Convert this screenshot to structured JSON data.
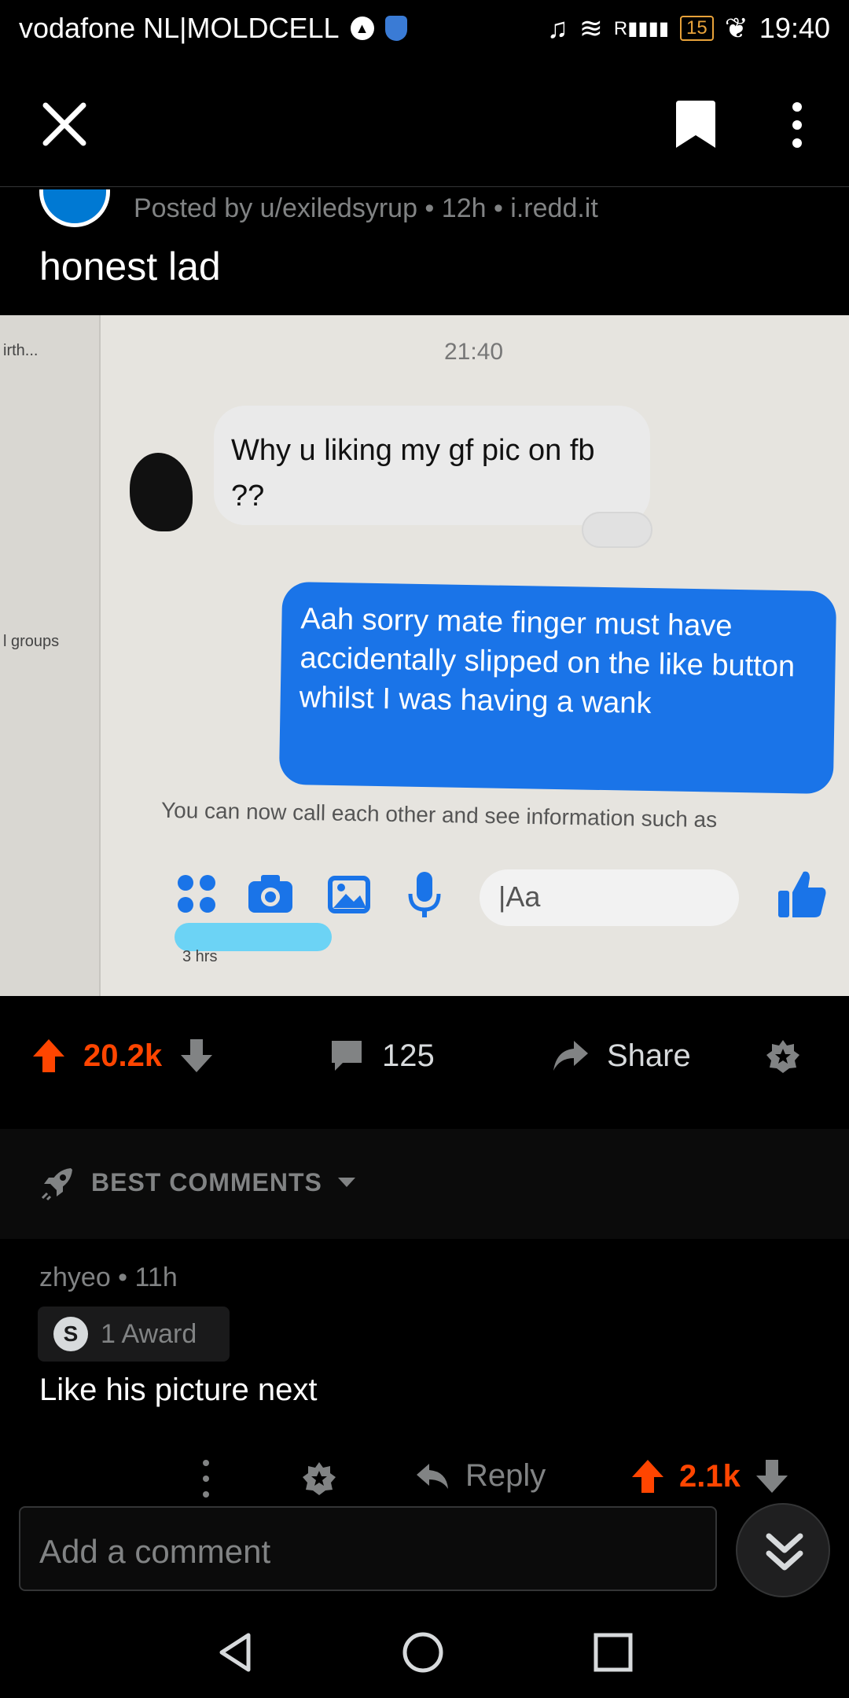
{
  "status_bar": {
    "carrier": "vodafone NL|MOLDCELL",
    "battery": "15",
    "time": "19:40",
    "signal_marker": "R"
  },
  "header": {
    "close_icon": "close-icon",
    "bookmark_icon": "bookmark-icon",
    "more_icon": "more-vertical-icon"
  },
  "post": {
    "posted_by": "Posted by u/exiledsyrup • 12h • i.redd.it",
    "title": "honest lad",
    "image": {
      "sidebar_text_1": "irth...",
      "sidebar_text_2": "l groups",
      "time": "21:40",
      "incoming_message": "Why u liking my gf pic on fb ??",
      "outgoing_message": "Aah sorry mate finger must have accidentally slipped on the like button whilst I was having a wank",
      "notice": "You can now call each other and see information such as",
      "input_placeholder": "|Aa",
      "time_ago": "3 hrs"
    }
  },
  "actions": {
    "score": "20.2k",
    "comments_count": "125",
    "share_label": "Share"
  },
  "sort": {
    "label": "BEST COMMENTS"
  },
  "comment": {
    "author_meta": "zhyeo • 11h",
    "award_label": "1 Award",
    "body": "Like his picture next",
    "reply_label": "Reply",
    "score": "2.1k"
  },
  "composer": {
    "placeholder": "Add a comment"
  },
  "colors": {
    "upvote": "#ff4500",
    "messenger_blue": "#1a74e8",
    "muted": "#818384"
  }
}
